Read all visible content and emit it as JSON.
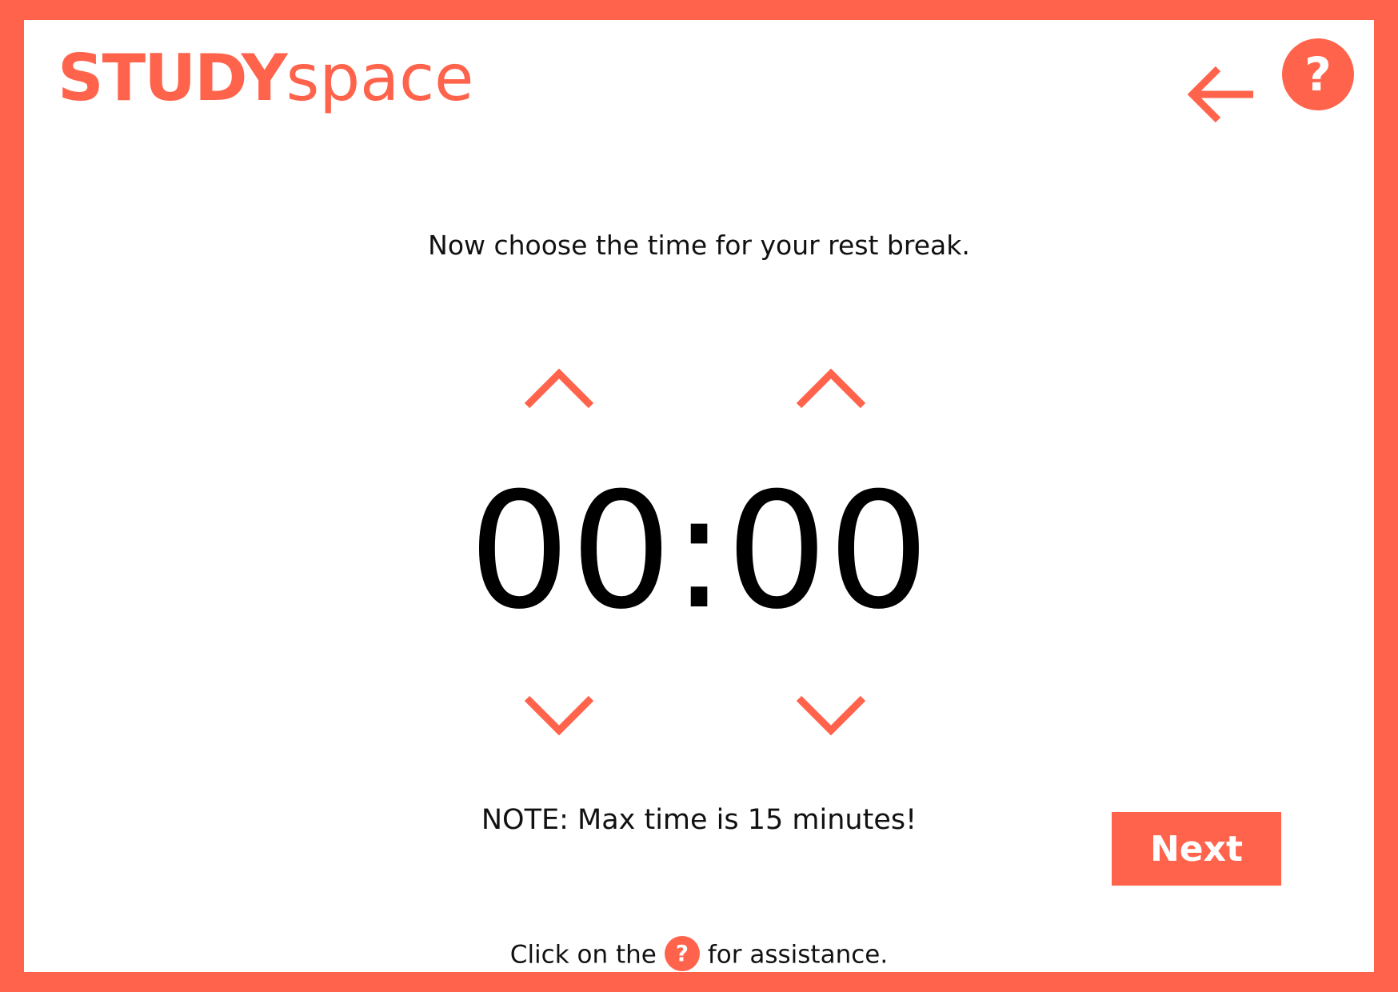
{
  "app": {
    "logo_bold": "STUDY",
    "logo_light": "space"
  },
  "header": {
    "back_icon": "arrow-left-icon",
    "help_icon": "question-icon",
    "help_label": "?"
  },
  "main": {
    "prompt": "Now choose the time for your rest break.",
    "minutes": "00",
    "separator": ":",
    "seconds": "00",
    "note": "NOTE: Max time is 15 minutes!",
    "next_label": "Next"
  },
  "footer": {
    "assist_before": "Click on the",
    "assist_icon_label": "?",
    "assist_after": "for assistance."
  },
  "colors": {
    "accent": "#ff634b",
    "text": "#111111",
    "background": "#ffffff"
  }
}
